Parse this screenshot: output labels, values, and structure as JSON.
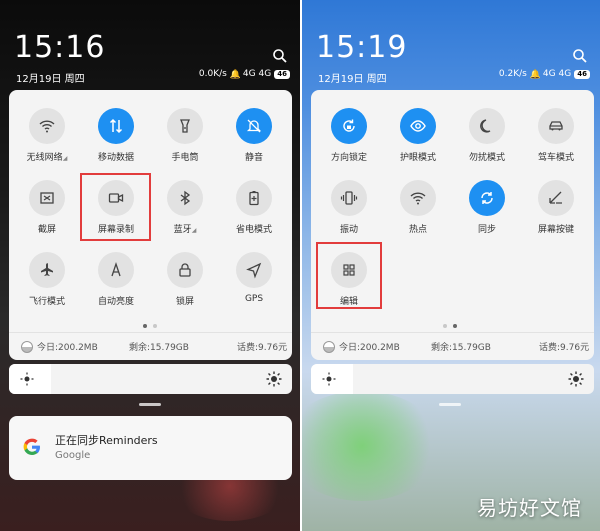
{
  "left": {
    "time": "15:16",
    "date": "12月19日 周四",
    "speed": "0.0K/s",
    "net1": "4G",
    "net2": "4G",
    "battery": "46",
    "tiles": [
      {
        "label": "无线网络",
        "suffix": "◢",
        "icon": "wifi",
        "on": false
      },
      {
        "label": "移动数据",
        "suffix": "",
        "icon": "data",
        "on": true
      },
      {
        "label": "手电筒",
        "suffix": "",
        "icon": "flashlight",
        "on": false
      },
      {
        "label": "静音",
        "suffix": "",
        "icon": "bell-off",
        "on": true
      },
      {
        "label": "截屏",
        "suffix": "",
        "icon": "screenshot",
        "on": false
      },
      {
        "label": "屏幕录制",
        "suffix": "",
        "icon": "camera",
        "on": false
      },
      {
        "label": "蓝牙",
        "suffix": "◢",
        "icon": "bluetooth",
        "on": false
      },
      {
        "label": "省电模式",
        "suffix": "",
        "icon": "battery",
        "on": false
      },
      {
        "label": "飞行模式",
        "suffix": "",
        "icon": "plane",
        "on": false
      },
      {
        "label": "自动亮度",
        "suffix": "",
        "icon": "auto-brightness",
        "on": false
      },
      {
        "label": "锁屏",
        "suffix": "",
        "icon": "lock",
        "on": false
      },
      {
        "label": "GPS",
        "suffix": "",
        "icon": "gps",
        "on": false
      }
    ],
    "footer": {
      "today": "今日:200.2MB",
      "remain": "剩余:15.79GB",
      "bill": "话费:9.76元"
    },
    "brightness_level": 0.15,
    "notification": {
      "title": "正在同步Reminders",
      "subtitle": "Google"
    }
  },
  "right": {
    "time": "15:19",
    "date": "12月19日 周四",
    "speed": "0.2K/s",
    "net1": "4G",
    "net2": "4G",
    "battery": "46",
    "tiles": [
      {
        "label": "方向锁定",
        "suffix": "",
        "icon": "rotation-lock",
        "on": true
      },
      {
        "label": "护眼模式",
        "suffix": "",
        "icon": "eye",
        "on": true
      },
      {
        "label": "勿扰模式",
        "suffix": "",
        "icon": "moon",
        "on": false
      },
      {
        "label": "驾车模式",
        "suffix": "",
        "icon": "car",
        "on": false
      },
      {
        "label": "振动",
        "suffix": "",
        "icon": "vibrate",
        "on": false
      },
      {
        "label": "热点",
        "suffix": "",
        "icon": "hotspot",
        "on": false
      },
      {
        "label": "同步",
        "suffix": "",
        "icon": "sync",
        "on": true
      },
      {
        "label": "屏幕按键",
        "suffix": "",
        "icon": "buttons",
        "on": false
      },
      {
        "label": "编辑",
        "suffix": "",
        "icon": "grid",
        "on": false
      }
    ],
    "footer": {
      "today": "今日:200.2MB",
      "remain": "剩余:15.79GB",
      "bill": "话费:9.76元"
    },
    "brightness_level": 0.15
  },
  "watermark": "易坊好文馆",
  "colors": {
    "accent": "#1e90f2",
    "highlight": "#e23c3c"
  }
}
